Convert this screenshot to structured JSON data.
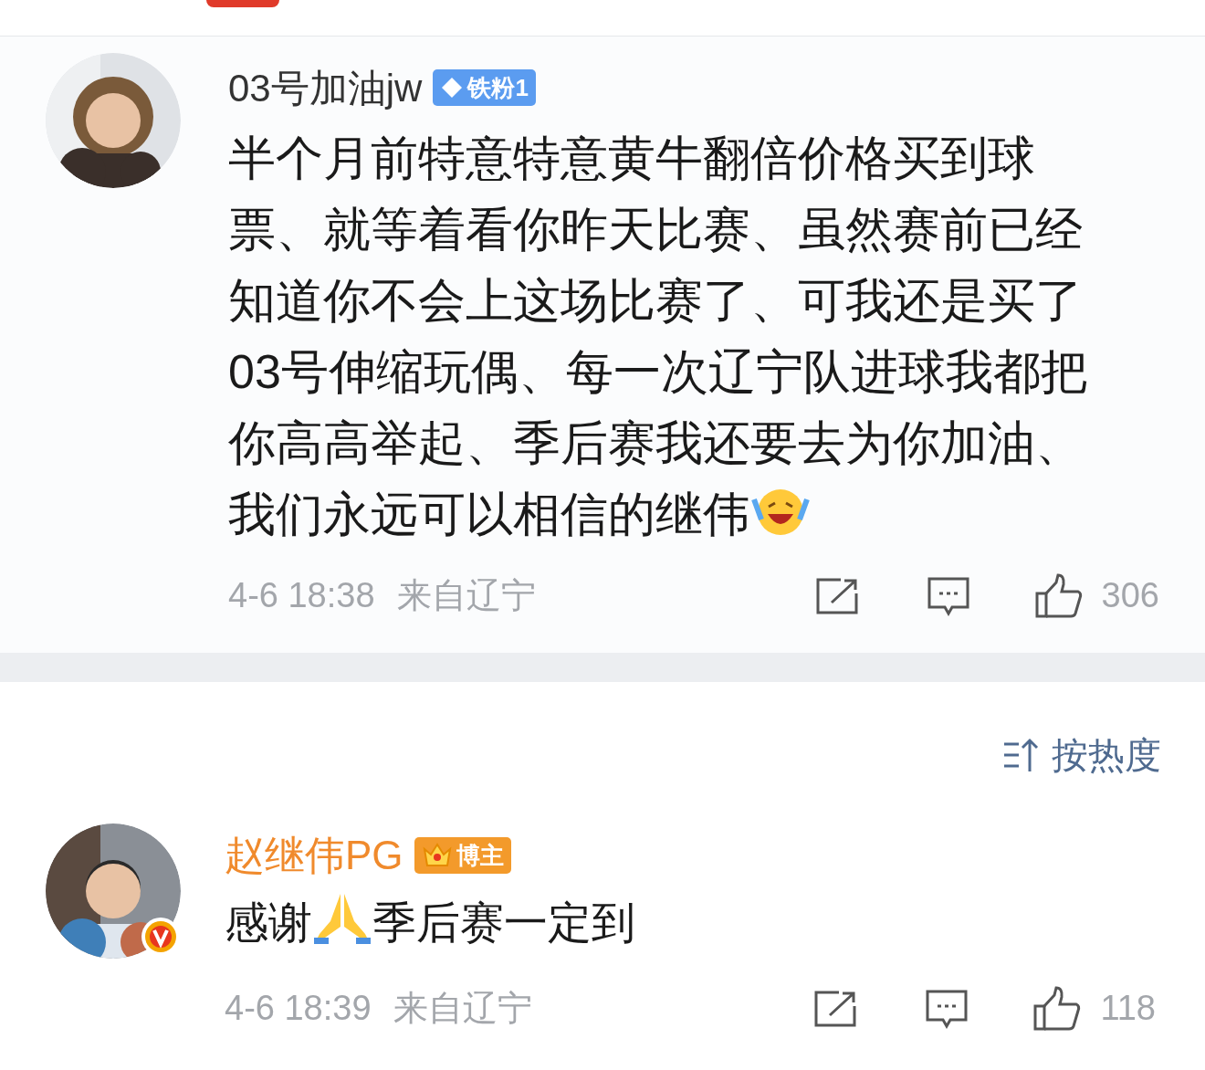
{
  "comments": [
    {
      "author": "03号加油jw",
      "badge": {
        "kind": "fan",
        "label": "铁粉1"
      },
      "text": "半个月前特意特意黄牛翻倍价格买到球票、就等着看你昨天比赛、虽然赛前已经知道你不会上这场比赛了、可我还是买了03号伸缩玩偶、每一次辽宁队进球我都把你高高举起、季后赛我还要去为你加油、我们永远可以相信的继伟",
      "emoji": {
        "kind": "laugh"
      },
      "time": "4-6 18:38",
      "location": "来自辽宁",
      "likes": "306"
    }
  ],
  "sort": {
    "label": "按热度"
  },
  "replies": [
    {
      "author": "赵继伟PG",
      "badge": {
        "kind": "blogger",
        "label": "博主"
      },
      "verified": true,
      "text_before": "感谢",
      "emoji": {
        "kind": "pray"
      },
      "text_after": "季后赛一定到",
      "time": "4-6 18:39",
      "location": "来自辽宁",
      "likes": "118"
    }
  ]
}
